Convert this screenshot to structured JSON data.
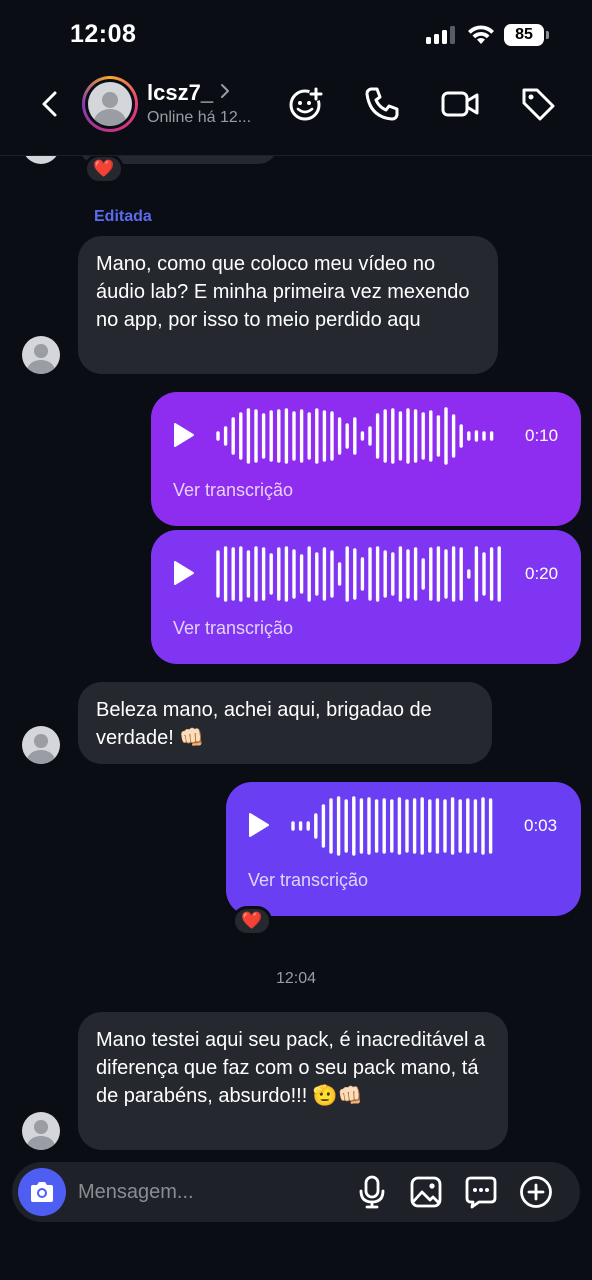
{
  "status_bar": {
    "time": "12:08",
    "battery": "85"
  },
  "header": {
    "name": "lcsz7_",
    "status": "Online há 12..."
  },
  "messages": {
    "edited_label": "Editada",
    "msg1": "Mano, como que coloco meu vídeo no áudio lab? E minha primeira vez mexendo no app, por isso to meio perdido aqu",
    "audio1": {
      "duration": "0:10",
      "transcription": "Ver transcrição"
    },
    "audio2": {
      "duration": "0:20",
      "transcription": "Ver transcrição"
    },
    "msg2": "Beleza mano, achei aqui, brigadao de verdade! 👊🏻",
    "audio3": {
      "duration": "0:03",
      "transcription": "Ver transcrição"
    },
    "time_separator": "12:04",
    "msg3": "Mano testei aqui seu pack, é inacreditável a diferença que faz com o seu pack mano, tá de parabéns, absurdo!!! 🫡👊🏻",
    "reaction": "❤️"
  },
  "composer": {
    "placeholder": "Mensagem..."
  },
  "icons": [
    "chevron-left-icon",
    "chevron-right-icon",
    "add-emoji-icon",
    "phone-icon",
    "video-camera-icon",
    "tag-icon",
    "camera-icon",
    "microphone-icon",
    "image-icon",
    "sticker-icon",
    "plus-circle-icon",
    "play-icon"
  ],
  "colors": {
    "accent": "#4f5ef2",
    "audio1": "#8e2df0",
    "audio2": "#7f35f1",
    "audio3": "#6a3ff3",
    "incoming_bubble": "#262830",
    "background": "#0b0d14"
  }
}
